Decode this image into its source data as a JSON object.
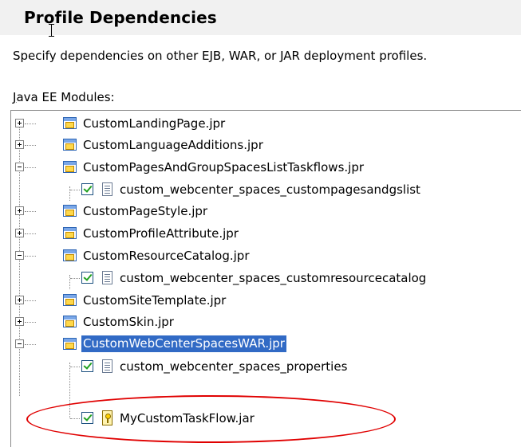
{
  "header": {
    "title": "Profile Dependencies"
  },
  "description": "Specify dependencies on other EJB, WAR, or JAR deployment profiles.",
  "section": {
    "label": "Java EE Modules:",
    "mnemonic": "J",
    "rest": "ava EE Modules:"
  },
  "tree": {
    "items": [
      {
        "label": "CustomLandingPage.jpr",
        "expanded": false,
        "icon": "folder-icon"
      },
      {
        "label": "CustomLanguageAdditions.jpr",
        "expanded": false,
        "icon": "folder-icon"
      },
      {
        "label": "CustomPagesAndGroupSpacesListTaskflows.jpr",
        "expanded": true,
        "icon": "folder-icon"
      },
      {
        "label": "custom_webcenter_spaces_custompagesandgslist",
        "checked": true,
        "icon": "document-icon"
      },
      {
        "label": "CustomPageStyle.jpr",
        "expanded": false,
        "icon": "folder-icon"
      },
      {
        "label": "CustomProfileAttribute.jpr",
        "expanded": false,
        "icon": "folder-icon"
      },
      {
        "label": "CustomResourceCatalog.jpr",
        "expanded": true,
        "icon": "folder-icon"
      },
      {
        "label": "custom_webcenter_spaces_customresourcecatalog",
        "checked": true,
        "icon": "document-icon"
      },
      {
        "label": "CustomSiteTemplate.jpr",
        "expanded": false,
        "icon": "folder-icon"
      },
      {
        "label": "CustomSkin.jpr",
        "expanded": false,
        "icon": "folder-icon"
      },
      {
        "label": "CustomWebCenterSpacesWAR.jpr",
        "expanded": true,
        "selected": true,
        "icon": "folder-icon"
      },
      {
        "label": "custom_webcenter_spaces_properties",
        "checked": true,
        "icon": "document-icon"
      },
      {
        "label": "MyCustomTaskFlow.jar",
        "checked": true,
        "icon": "jar-icon"
      }
    ]
  },
  "colors": {
    "selection": "#316ac5",
    "annotation": "#e00000",
    "header_bg": "#f1f1f1"
  }
}
